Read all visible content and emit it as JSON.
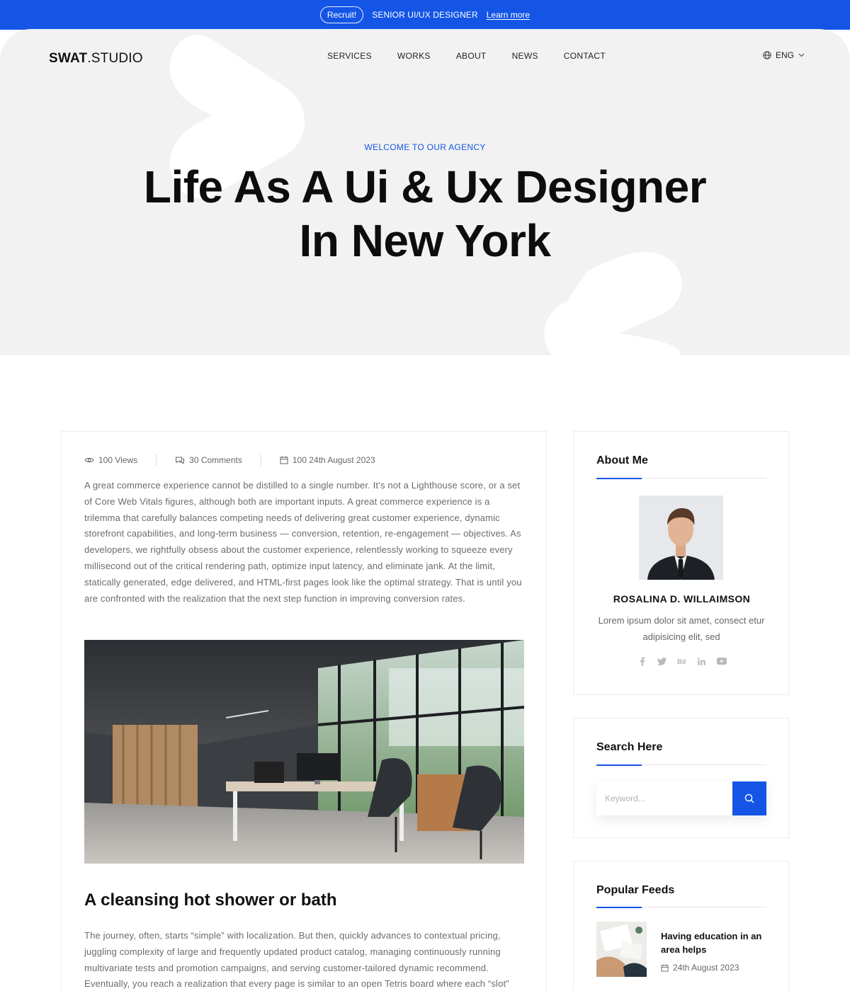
{
  "topbar": {
    "badge": "Recruit!",
    "text": "SENIOR UI/UX DESIGNER",
    "link": "Learn more"
  },
  "header": {
    "brand_bold": "SWAT",
    "brand_light": ".STUDIO",
    "nav": [
      "SERVICES",
      "WORKS",
      "ABOUT",
      "NEWS",
      "CONTACT"
    ],
    "language": "ENG"
  },
  "hero": {
    "eyebrow": "WELCOME TO OUR AGENCY",
    "title_line1": "Life As A Ui & Ux Designer",
    "title_line2": "In New York"
  },
  "article": {
    "meta": {
      "views": "100 Views",
      "comments": "30 Comments",
      "date": "100 24th August 2023"
    },
    "paragraph1": "A great commerce experience cannot be distilled to a single number. It’s not a Lighthouse score, or a set of Core Web Vitals figures, although both are important inputs. A great commerce experience is a trilemma that carefully balances competing needs of delivering great customer experience, dynamic storefront capabilities, and long-term business — conversion, retention, re-engagement — objectives. As developers, we rightfully obsess about the customer experience, relentlessly working to squeeze every millisecond out of the critical rendering path, optimize input latency, and eliminate jank. At the limit, statically generated, edge delivered, and HTML-first pages look like the optimal strategy. That is until you are confronted with the realization that the next step function in improving conversion rates.",
    "heading": "A cleansing hot shower or bath",
    "paragraph2": "The journey, often, starts “simple” with localization. But then, quickly advances to contextual pricing, juggling complexity of large and frequently updated product catalog, managing continuously running multivariate tests and promotion campaigns, and serving customer-tailored dynamic recommend. Eventually, you reach a realization that every page is similar to an open Tetris board where each “slot”"
  },
  "sidebar": {
    "about": {
      "title": "About Me",
      "name": "ROSALINA D. WILLAIMSON",
      "bio": "Lorem ipsum dolor sit amet, consect etur adipisicing elit, sed",
      "socials": [
        "facebook-icon",
        "twitter-icon",
        "behance-icon",
        "linkedin-icon",
        "youtube-icon"
      ]
    },
    "search": {
      "title": "Search Here",
      "placeholder": "Keyword..."
    },
    "feeds": {
      "title": "Popular Feeds",
      "items": [
        {
          "title": "Having education in an area helps",
          "date": "24th August 2023"
        }
      ]
    }
  },
  "colors": {
    "accent": "#1455e6",
    "hero_bg": "#f2f2f2",
    "text_muted": "#6b6b6b"
  }
}
